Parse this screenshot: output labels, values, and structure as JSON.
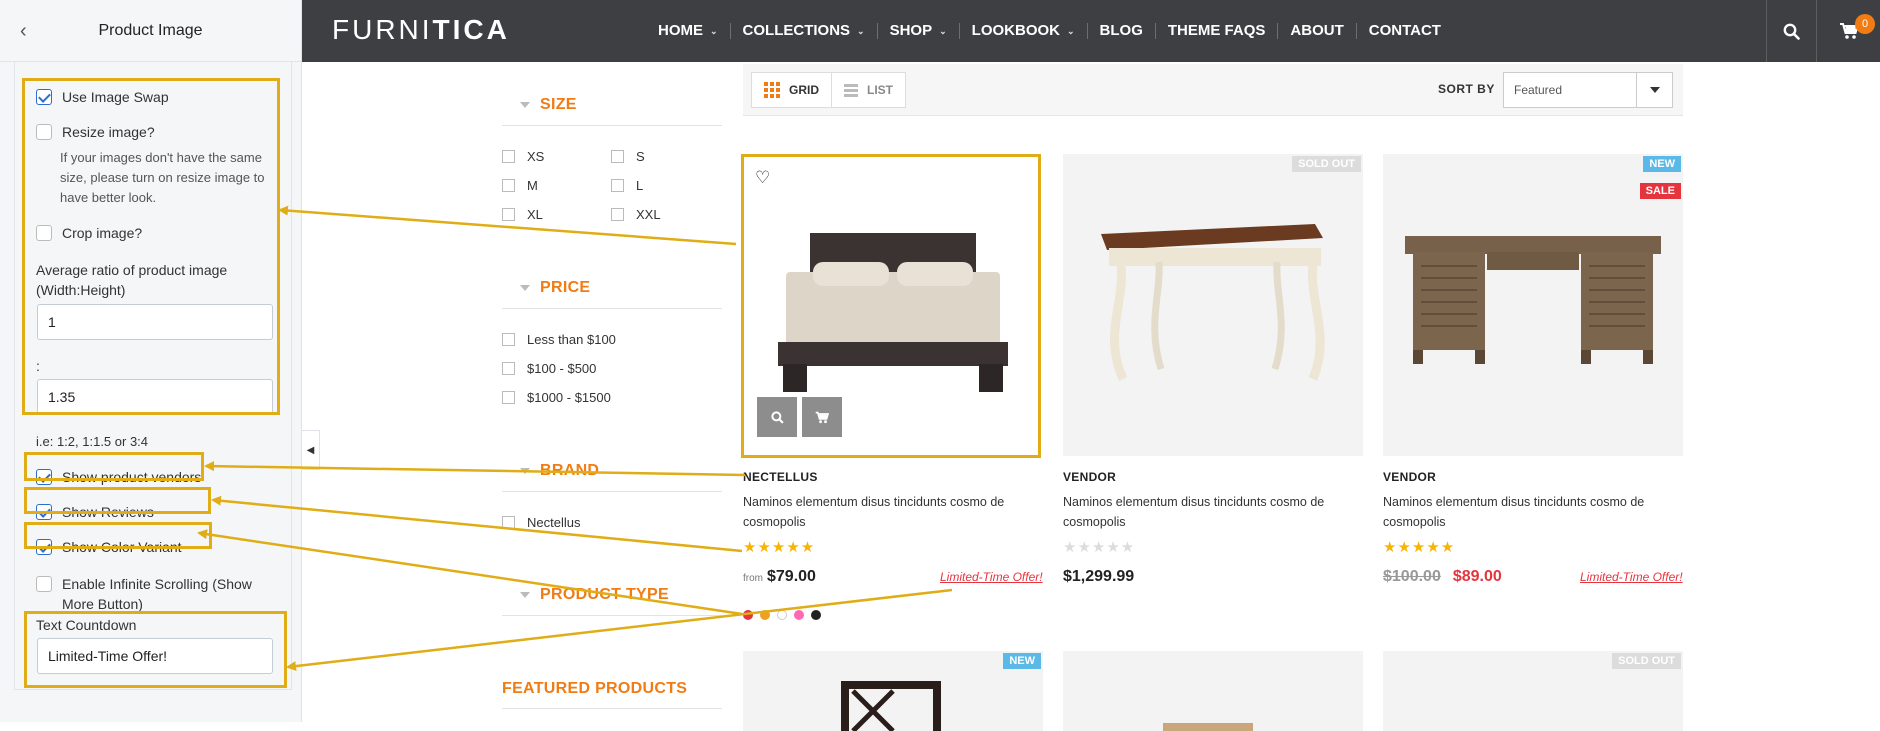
{
  "panel": {
    "title": "Product Image",
    "use_image_swap": "Use Image Swap",
    "resize_image": "Resize image?",
    "resize_help": "If your images don't have the same size, please turn on resize image to have better look.",
    "crop_image": "Crop image?",
    "ratio_label": "Average ratio of product image (Width:Height)",
    "ratio_width": "1",
    "ratio_sep": ":",
    "ratio_height": "1.35",
    "ratio_hint": "i.e: 1:2, 1:1.5 or 3:4",
    "show_vendors": "Show product vendors",
    "show_reviews": "Show Reviews",
    "show_color_variant": "Show Color Variant",
    "infinite_scroll": "Enable Infinite Scrolling (Show More Button)",
    "text_countdown_label": "Text Countdown",
    "text_countdown_value": "Limited-Time Offer!",
    "highlight_color": "#e0ad16"
  },
  "header": {
    "logo_light": "FURNI",
    "logo_bold": "TICA",
    "nav": {
      "home": "HOME",
      "collections": "COLLECTIONS",
      "shop": "SHOP",
      "lookbook": "LOOKBOOK",
      "blog": "BLOG",
      "theme_faqs": "THEME FAQS",
      "about": "ABOUT",
      "contact": "CONTACT"
    },
    "cart_count": "0",
    "bg_color": "#3d3f43"
  },
  "filters": {
    "size_title": "SIZE",
    "sizes": [
      "XS",
      "S",
      "M",
      "L",
      "XL",
      "XXL"
    ],
    "price_title": "PRICE",
    "prices": [
      "Less than $100",
      "$100 - $500",
      "$1000 - $1500"
    ],
    "brand_title": "BRAND",
    "brands": [
      "Nectellus"
    ],
    "product_type_title": "PRODUCT TYPE",
    "featured_title": "FEATURED PRODUCTS",
    "accent_color": "#f07c13"
  },
  "toolbar": {
    "grid_label": "GRID",
    "list_label": "LIST",
    "sort_label": "SORT BY",
    "sort_value": "Featured"
  },
  "products": [
    {
      "vendor": "NECTELLUS",
      "desc": "Naminos elementum disus tincidunts cosmo de cosmopolis",
      "rating": 5,
      "price_from": "from",
      "price": "$79.00",
      "offer": "Limited-Time Offer!"
    },
    {
      "badge": "SOLD OUT",
      "vendor": "VENDOR",
      "desc": "Naminos elementum disus tincidunts cosmo de cosmopolis",
      "rating": 0,
      "price": "$1,299.99"
    },
    {
      "badge_new": "NEW",
      "badge_sale": "SALE",
      "vendor": "VENDOR",
      "desc": "Naminos elementum disus tincidunts cosmo de cosmopolis",
      "rating": 5,
      "old_price": "$100.00",
      "price": "$89.00",
      "offer": "Limited-Time Offer!"
    }
  ],
  "swatches": [
    "#e5343e",
    "#f0a020",
    "#ffffff",
    "#ff69b4",
    "#222222"
  ],
  "row2_badges": [
    "NEW",
    "SOLD OUT"
  ]
}
